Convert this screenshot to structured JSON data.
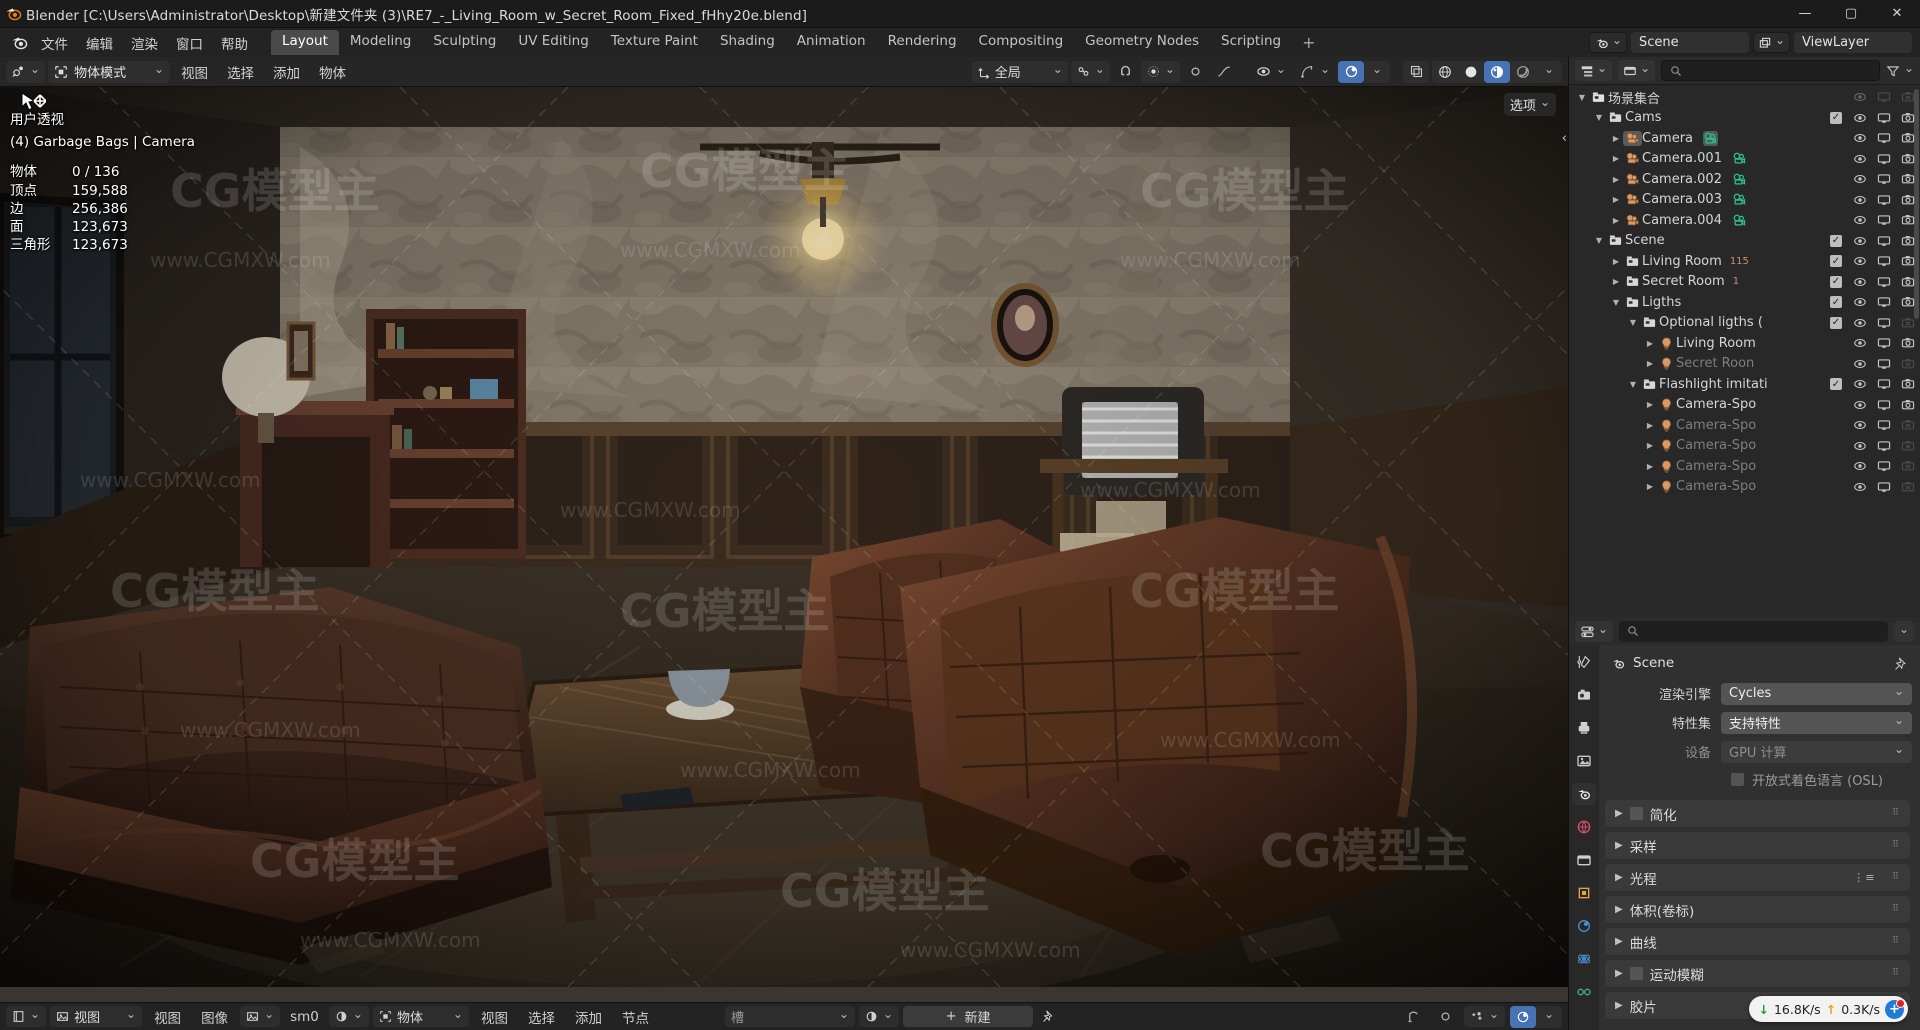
{
  "window": {
    "title": "Blender [C:\\Users\\Administrator\\Desktop\\新建文件夹 (3)\\RE7_-_Living_Room_w_Secret_Room_Fixed_fHhy20e.blend]",
    "minimize": "—",
    "maximize": "▢",
    "close": "✕"
  },
  "topbar": {
    "menus": [
      "文件",
      "编辑",
      "渲染",
      "窗口",
      "帮助"
    ],
    "workspace_tabs": [
      {
        "label": "Layout",
        "active": true
      },
      {
        "label": "Modeling",
        "active": false
      },
      {
        "label": "Sculpting",
        "active": false
      },
      {
        "label": "UV Editing",
        "active": false
      },
      {
        "label": "Texture Paint",
        "active": false
      },
      {
        "label": "Shading",
        "active": false
      },
      {
        "label": "Animation",
        "active": false
      },
      {
        "label": "Rendering",
        "active": false
      },
      {
        "label": "Compositing",
        "active": false
      },
      {
        "label": "Geometry Nodes",
        "active": false
      },
      {
        "label": "Scripting",
        "active": false
      }
    ],
    "add_workspace": "+",
    "scene_name": "Scene",
    "viewlayer_name": "ViewLayer"
  },
  "viewport_header": {
    "mode": "物体模式",
    "menus": [
      "视图",
      "选择",
      "添加",
      "物体"
    ],
    "transform_orientation": "全局",
    "snap_label": "",
    "proportional_label": ""
  },
  "viewport": {
    "view_name": "用户透视",
    "active_object": "(4) Garbage Bags | Camera",
    "stats": [
      {
        "key": "物体",
        "value": "0 / 136"
      },
      {
        "key": "顶点",
        "value": "159,588"
      },
      {
        "key": "边",
        "value": "256,386"
      },
      {
        "key": "面",
        "value": "123,673"
      },
      {
        "key": "三角形",
        "value": "123,673"
      }
    ],
    "options_label": "选项"
  },
  "outliner": {
    "search_placeholder": "",
    "rows": [
      {
        "depth": 0,
        "tri": "down",
        "icon": "collection-icon",
        "label": "场景集合",
        "check": false,
        "eye": false,
        "screen": false,
        "camera": false,
        "kind": "scene-collection"
      },
      {
        "depth": 1,
        "tri": "down",
        "icon": "collection-icon",
        "label": "Cams",
        "check": true,
        "eye": true,
        "screen": true,
        "camera": true,
        "kind": "collection"
      },
      {
        "depth": 2,
        "tri": "right",
        "icon": "camera-object-icon",
        "label": "Camera",
        "check": false,
        "eye": true,
        "screen": true,
        "camera": true,
        "kind": "object",
        "data_icon": "camera-data-icon",
        "highlight": true
      },
      {
        "depth": 2,
        "tri": "right",
        "icon": "camera-object-icon",
        "label": "Camera.001",
        "check": false,
        "eye": true,
        "screen": true,
        "camera": true,
        "kind": "object",
        "data_icon": "camera-data-icon"
      },
      {
        "depth": 2,
        "tri": "right",
        "icon": "camera-object-icon",
        "label": "Camera.002",
        "check": false,
        "eye": true,
        "screen": true,
        "camera": true,
        "kind": "object",
        "data_icon": "camera-data-icon"
      },
      {
        "depth": 2,
        "tri": "right",
        "icon": "camera-object-icon",
        "label": "Camera.003",
        "check": false,
        "eye": true,
        "screen": true,
        "camera": true,
        "kind": "object",
        "data_icon": "camera-data-icon"
      },
      {
        "depth": 2,
        "tri": "right",
        "icon": "camera-object-icon",
        "label": "Camera.004",
        "check": false,
        "eye": true,
        "screen": true,
        "camera": true,
        "kind": "object",
        "data_icon": "camera-data-icon"
      },
      {
        "depth": 1,
        "tri": "down",
        "icon": "collection-icon",
        "label": "Scene",
        "check": true,
        "eye": true,
        "screen": true,
        "camera": true,
        "kind": "collection"
      },
      {
        "depth": 2,
        "tri": "right",
        "icon": "collection-icon",
        "label": "Living Room",
        "check": true,
        "eye": true,
        "screen": true,
        "camera": true,
        "kind": "collection",
        "badge": "115"
      },
      {
        "depth": 2,
        "tri": "right",
        "icon": "collection-icon",
        "label": "Secret Room",
        "check": true,
        "eye": true,
        "screen": true,
        "camera": true,
        "kind": "collection",
        "badge": "1"
      },
      {
        "depth": 2,
        "tri": "down",
        "icon": "collection-icon",
        "label": "Ligths",
        "check": true,
        "eye": true,
        "screen": true,
        "camera": true,
        "kind": "collection"
      },
      {
        "depth": 3,
        "tri": "down",
        "icon": "collection-icon",
        "label": "Optional ligths (",
        "check": true,
        "eye": true,
        "screen": true,
        "camera": false,
        "kind": "collection"
      },
      {
        "depth": 4,
        "tri": "right",
        "icon": "light-icon",
        "label": "Living Room",
        "check": false,
        "eye": true,
        "screen": true,
        "camera": true,
        "kind": "object"
      },
      {
        "depth": 4,
        "tri": "right",
        "icon": "light-icon",
        "label": "Secret Roon",
        "check": false,
        "eye": true,
        "screen": true,
        "camera": false,
        "kind": "object",
        "dim": true
      },
      {
        "depth": 3,
        "tri": "down",
        "icon": "collection-icon",
        "label": "Flashlight imitati",
        "check": true,
        "eye": true,
        "screen": true,
        "camera": true,
        "kind": "collection"
      },
      {
        "depth": 4,
        "tri": "right",
        "icon": "light-icon",
        "label": "Camera-Spo",
        "check": false,
        "eye": true,
        "screen": true,
        "camera": true,
        "kind": "object"
      },
      {
        "depth": 4,
        "tri": "right",
        "icon": "light-icon",
        "label": "Camera-Spo",
        "check": false,
        "eye": true,
        "screen": true,
        "camera": false,
        "kind": "object",
        "dim": true
      },
      {
        "depth": 4,
        "tri": "right",
        "icon": "light-icon",
        "label": "Camera-Spo",
        "check": false,
        "eye": true,
        "screen": true,
        "camera": false,
        "kind": "object",
        "dim": true
      },
      {
        "depth": 4,
        "tri": "right",
        "icon": "light-icon",
        "label": "Camera-Spo",
        "check": false,
        "eye": true,
        "screen": true,
        "camera": false,
        "kind": "object",
        "dim": true
      },
      {
        "depth": 4,
        "tri": "right",
        "icon": "light-icon",
        "label": "Camera-Spo",
        "check": false,
        "eye": true,
        "screen": true,
        "camera": false,
        "kind": "object",
        "dim": true
      }
    ]
  },
  "properties": {
    "breadcrumb": "Scene",
    "search_placeholder": "",
    "rows": [
      {
        "label": "渲染引擎",
        "value": "Cycles",
        "disabled": false,
        "dropdown": true
      },
      {
        "label": "特性集",
        "value": "支持特性",
        "disabled": false,
        "dropdown": true
      },
      {
        "label": "设备",
        "value": "GPU 计算",
        "disabled": true,
        "dropdown": true
      }
    ],
    "osl_label": "开放式着色语言 (OSL)",
    "panels": [
      {
        "label": "简化",
        "checkbox": true,
        "list_icon": false
      },
      {
        "label": "采样",
        "checkbox": false,
        "list_icon": false
      },
      {
        "label": "光程",
        "checkbox": false,
        "list_icon": true
      },
      {
        "label": "体积(卷标)",
        "checkbox": false,
        "list_icon": false
      },
      {
        "label": "曲线",
        "checkbox": false,
        "list_icon": false
      },
      {
        "label": "运动模糊",
        "checkbox": true,
        "list_icon": false
      },
      {
        "label": "胶片",
        "checkbox": false,
        "list_icon": false
      }
    ]
  },
  "statusbar": {
    "view_label": "视图",
    "menus_left": [
      "视图",
      "图像"
    ],
    "image_name": "sm0",
    "object_mode": "物体",
    "menus_right": [
      "视图",
      "选择",
      "添加",
      "节点"
    ],
    "slot_label": "槽",
    "new_label": "新建",
    "plus": "+"
  },
  "net_widget": {
    "down_arrow": "↓",
    "down_speed": "16.8K/s",
    "up_arrow": "↑",
    "up_speed": "0.3K/s",
    "badge": "+"
  },
  "watermark": {
    "text1": "CGMXW.com",
    "text2": "模型主"
  },
  "colors": {
    "accent_blue": "#4772b3",
    "panel_bg": "#303030",
    "header_bg": "#2b2b2b",
    "outliner_bg": "#282828",
    "text": "#e5e5e5",
    "camera_orange": "#d89b6a",
    "camera_data_green": "#2fbf8f"
  }
}
